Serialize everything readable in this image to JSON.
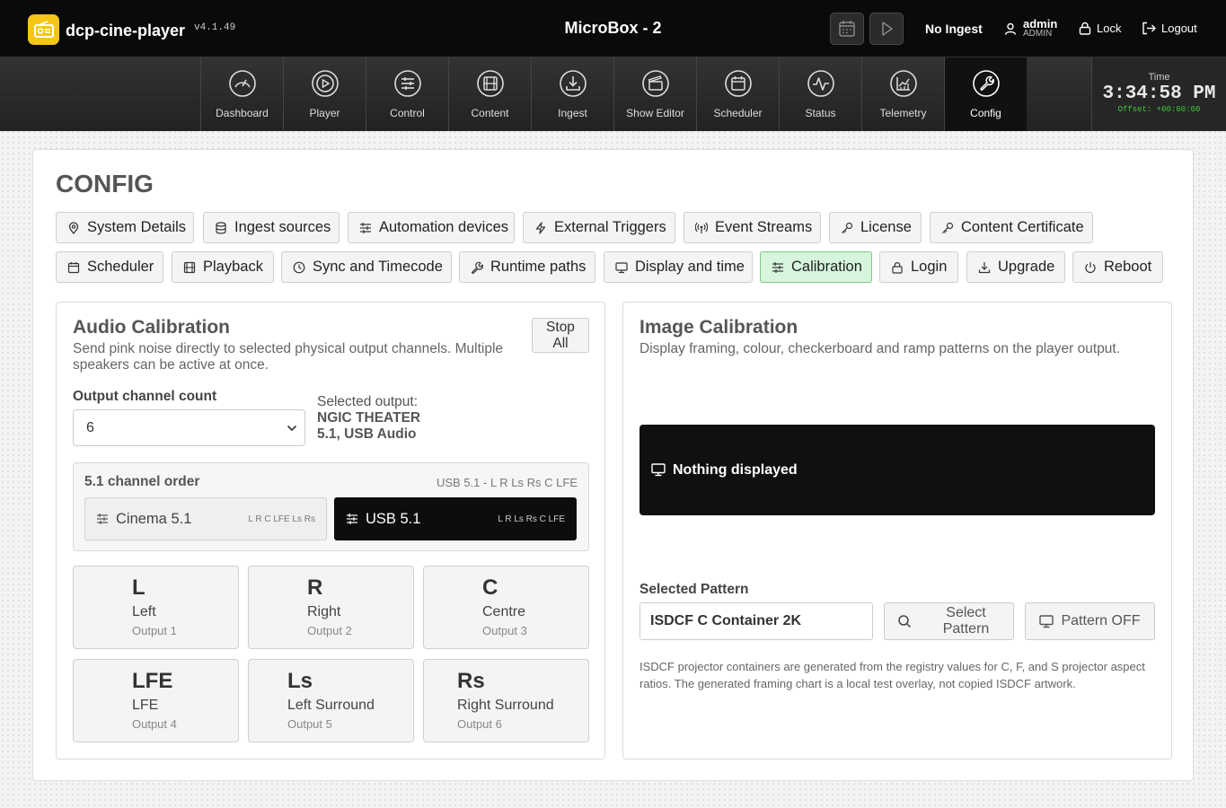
{
  "header": {
    "app_name": "dcp-cine-player",
    "version": "v4.1.49",
    "machine_name": "MicroBox - 2",
    "ingest_status": "No Ingest",
    "user": {
      "name": "admin",
      "role": "ADMIN"
    },
    "lock_label": "Lock",
    "logout_label": "Logout"
  },
  "nav": {
    "items": [
      {
        "label": "Dashboard",
        "icon": "gauge-icon"
      },
      {
        "label": "Player",
        "icon": "play-circle-icon"
      },
      {
        "label": "Control",
        "icon": "sliders-icon"
      },
      {
        "label": "Content",
        "icon": "film-icon"
      },
      {
        "label": "Ingest",
        "icon": "download-icon"
      },
      {
        "label": "Show Editor",
        "icon": "clapperboard-icon"
      },
      {
        "label": "Scheduler",
        "icon": "calendar-icon"
      },
      {
        "label": "Status",
        "icon": "pulse-icon"
      },
      {
        "label": "Telemetry",
        "icon": "chart-icon"
      },
      {
        "label": "Config",
        "icon": "wrench-icon",
        "active": true
      }
    ],
    "clock": {
      "label": "Time",
      "time": "3:34:58 PM",
      "offset": "Offset: +00:00:00"
    }
  },
  "page": {
    "title": "CONFIG",
    "tabs": [
      {
        "label": "System Details",
        "icon": "pin-icon"
      },
      {
        "label": "Ingest sources",
        "icon": "database-icon"
      },
      {
        "label": "Automation devices",
        "icon": "sliders-icon"
      },
      {
        "label": "External Triggers",
        "icon": "bolt-icon"
      },
      {
        "label": "Event Streams",
        "icon": "broadcast-icon"
      },
      {
        "label": "License",
        "icon": "key-icon"
      },
      {
        "label": "Content Certificate",
        "icon": "key-icon"
      },
      {
        "label": "Scheduler",
        "icon": "calendar-icon"
      },
      {
        "label": "Playback",
        "icon": "film-icon"
      },
      {
        "label": "Sync and Timecode",
        "icon": "clock-icon"
      },
      {
        "label": "Runtime paths",
        "icon": "wrench-icon"
      },
      {
        "label": "Display and time",
        "icon": "monitor-icon"
      },
      {
        "label": "Calibration",
        "icon": "sliders-icon",
        "active": true
      },
      {
        "label": "Login",
        "icon": "lock-icon"
      },
      {
        "label": "Upgrade",
        "icon": "download-icon"
      },
      {
        "label": "Reboot",
        "icon": "power-icon"
      }
    ]
  },
  "audio": {
    "title": "Audio Calibration",
    "desc_line1": "Send pink noise directly to selected physical output channels. Multiple",
    "desc_line2": "speakers can be active at once.",
    "stop_line1": "Stop",
    "stop_line2": "All",
    "count_label": "Output channel count",
    "count_value": "6",
    "selected_label": "Selected output:",
    "selected_line1": "NGIC THEATER",
    "selected_line2": "5.1, USB Audio",
    "order_title": "5.1 channel order",
    "order_current": "USB 5.1 - L R Ls Rs C LFE",
    "order_options": [
      {
        "label": "Cinema 5.1",
        "order": "L R C LFE Ls Rs"
      },
      {
        "label": "USB 5.1",
        "order": "L R Ls Rs C LFE",
        "active": true
      }
    ],
    "speakers": [
      {
        "abbr": "L",
        "name": "Left",
        "output": "Output 1"
      },
      {
        "abbr": "R",
        "name": "Right",
        "output": "Output 2"
      },
      {
        "abbr": "C",
        "name": "Centre",
        "output": "Output 3"
      },
      {
        "abbr": "LFE",
        "name": "LFE",
        "output": "Output 4"
      },
      {
        "abbr": "Ls",
        "name": "Left Surround",
        "output": "Output 5"
      },
      {
        "abbr": "Rs",
        "name": "Right Surround",
        "output": "Output 6"
      }
    ]
  },
  "image": {
    "title": "Image Calibration",
    "desc": "Display framing, colour, checkerboard and ramp patterns on the player output.",
    "display_status": "Nothing displayed",
    "pattern_label": "Selected Pattern",
    "pattern_value": "ISDCF C Container 2K",
    "select_line1": "Select",
    "select_line2": "Pattern",
    "off_label": "Pattern OFF",
    "note_line1": "ISDCF projector containers are generated from the registry values for C, F, and S projector aspect",
    "note_line2": "ratios. The generated framing chart is a local test overlay, not copied ISDCF artwork."
  },
  "colors": {
    "accent_green": "#d6f5dc",
    "logo_yellow": "#f5c518",
    "header_bg": "#0a0a0a",
    "offset_green": "#3ec63e"
  }
}
